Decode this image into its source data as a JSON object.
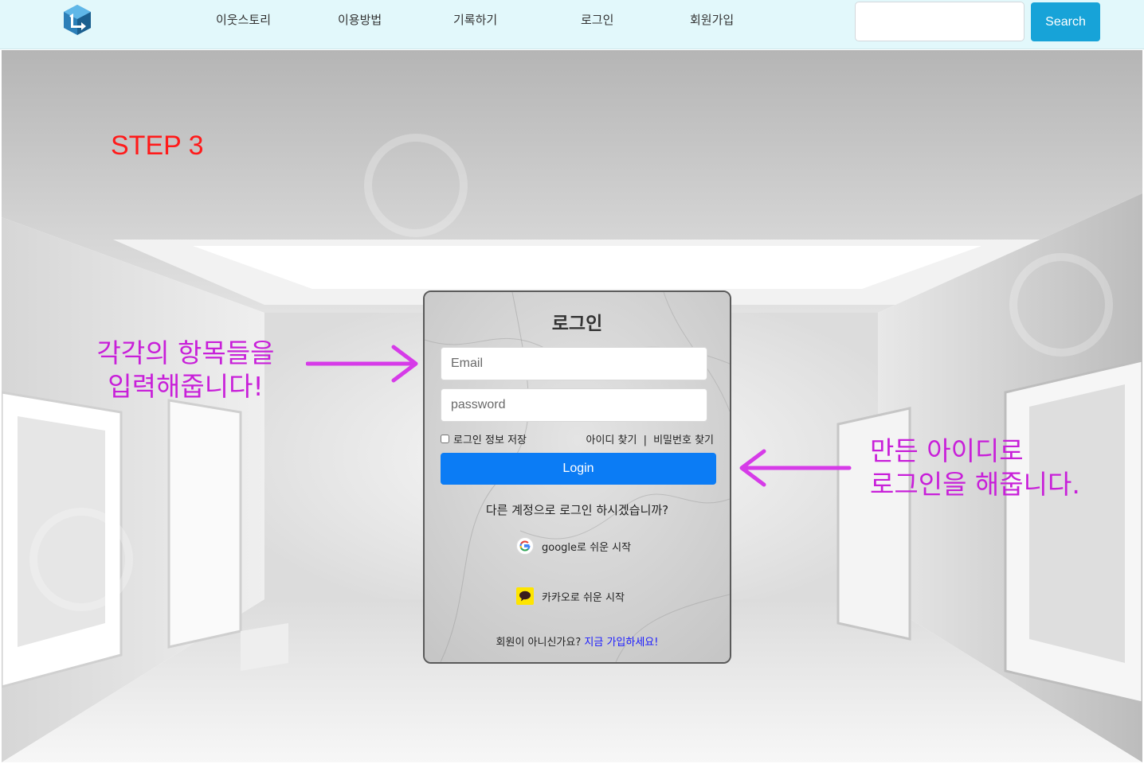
{
  "nav": {
    "logo": "logo",
    "links": [
      "이웃스토리",
      "이용방법",
      "기록하기",
      "로그인",
      "회원가입"
    ],
    "search_placeholder": "",
    "search_label": "Search"
  },
  "annotations": {
    "step": "STEP 3",
    "left_line1": "각각의 항목들을",
    "left_line2": "입력해줍니다!",
    "right_line1": "만든 아이디로",
    "right_line2": "로그인을 해줍니다.",
    "arrow_color": "#d63be8"
  },
  "login": {
    "title": "로그인",
    "email_placeholder": "Email",
    "password_placeholder": "password",
    "remember_label": "로그인 정보 저장",
    "find_id": "아이디 찾기",
    "find_sep": "|",
    "find_password": "비밀번호 찾기",
    "login_button": "Login",
    "alt_prompt": "다른 계정으로 로그인 하시겠습니까?",
    "google_label": "google로 쉬운 시작",
    "kakao_label": "카카오로 쉬운 시작",
    "signup_prompt": "회원이 아니신가요?",
    "signup_link": "지금 가입하세요!"
  },
  "colors": {
    "navbar_bg": "#e2f8fb",
    "search_button": "#17a3d8",
    "login_button": "#0b7cf5",
    "step_text": "#ff1a1a",
    "annotation_text": "#c81fd9",
    "kakao_yellow": "#fee500"
  }
}
